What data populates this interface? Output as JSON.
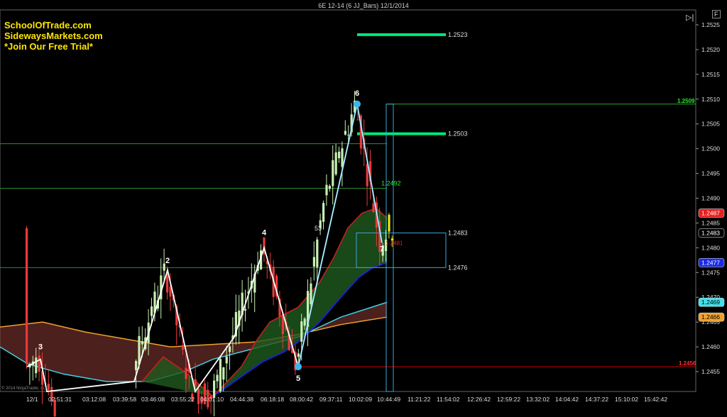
{
  "window": {
    "title": "6E 12-14 (6 JJ_Bars)  12/1/2014",
    "collapse_icon": "collapse-panel-icon",
    "f_button_label": "F"
  },
  "branding": {
    "line1": "SchoolOfTrade.com",
    "line2": "SidewaysMarkets.com",
    "line3": "*Join Our Free Trial*",
    "copyright": "© 2014 NinjaTrader, LLC"
  },
  "colors": {
    "background": "#000000",
    "up_bar": "#c7efb2",
    "down_bar": "#e83a3a",
    "swing_line": "#ffffff",
    "leg_line": "#55c8ee",
    "target_level": "#00e87a",
    "support_line": "#2e8b2e",
    "low_line": "#cc0000",
    "ma_fast": "#cc1f1f",
    "ma_mid": "#1a24c8",
    "ma_slow_upper": "#f0a030",
    "ma_slow_lower": "#40d0e0",
    "yellow_highlight": "#f2e600"
  },
  "chart_data": {
    "type": "candlestick",
    "title": "6E 12-14 (6 JJ_Bars)  12/1/2014",
    "ylim": [
      1.2451,
      1.2528
    ],
    "y_ticks": [
      "1.2455",
      "1.2460",
      "1.2465",
      "1.2470",
      "1.2475",
      "1.2480",
      "1.2485",
      "1.2490",
      "1.2495",
      "1.2500",
      "1.2505",
      "1.2510",
      "1.2515",
      "1.2520",
      "1.2525"
    ],
    "x_ticks": [
      "12/1",
      "02:51:31",
      "03:12:08",
      "03:39:58",
      "03:46:08",
      "03:55:22",
      "04:01:10",
      "04:44:38",
      "06:18:18",
      "08:00:42",
      "09:37:11",
      "10:02:09",
      "10:44:49",
      "11:21:22",
      "11:54:02",
      "12:26:42",
      "12:59:22",
      "13:32:02",
      "14:04:42",
      "14:37:22",
      "15:10:02",
      "15:42:42"
    ],
    "price_labels": [
      {
        "value": 1.2487,
        "text": "1.2487",
        "color": "#e62020",
        "text_color": "#ffffff"
      },
      {
        "value": 1.2483,
        "text": "1.2483",
        "color": "#000000",
        "text_color": "#ffffff"
      },
      {
        "value": 1.2477,
        "text": "1.2477",
        "color": "#1a2ae6",
        "text_color": "#ffffff"
      },
      {
        "value": 1.2469,
        "text": "1.2469",
        "color": "#40e0e8",
        "text_color": "#000000"
      },
      {
        "value": 1.2466,
        "text": "1.2466",
        "color": "#f0a030",
        "text_color": "#000000"
      }
    ],
    "horizontal_levels": [
      {
        "value": 1.2523,
        "label": "1.2523",
        "kind": "target"
      },
      {
        "value": 1.2503,
        "label": "1.2503",
        "kind": "target"
      },
      {
        "value": 1.2509,
        "label": "1.2509",
        "kind": "high"
      },
      {
        "value": 1.2501,
        "label": "",
        "kind": "support"
      },
      {
        "value": 1.2492,
        "label": "1.2492",
        "kind": "support"
      },
      {
        "value": 1.2476,
        "label": "",
        "kind": "support"
      },
      {
        "value": 1.2456,
        "label": "1.2456",
        "kind": "low"
      }
    ],
    "zone": {
      "top": 1.2483,
      "bottom": 1.2476,
      "top_label": "1.2483",
      "bottom_label": "1.2476"
    },
    "pivots": [
      {
        "label": "2",
        "price": 1.24755
      },
      {
        "label": "3",
        "price": 1.24575
      },
      {
        "label": "4",
        "price": 1.248
      },
      {
        "label": "5",
        "price": 1.2456
      },
      {
        "label": "6",
        "price": 1.2509
      },
      {
        "label": "7",
        "price": 1.2481
      }
    ],
    "annotations": [
      {
        "text": "53",
        "price": 1.24835
      },
      {
        "text": "1.2481",
        "price": 1.2481
      }
    ]
  }
}
